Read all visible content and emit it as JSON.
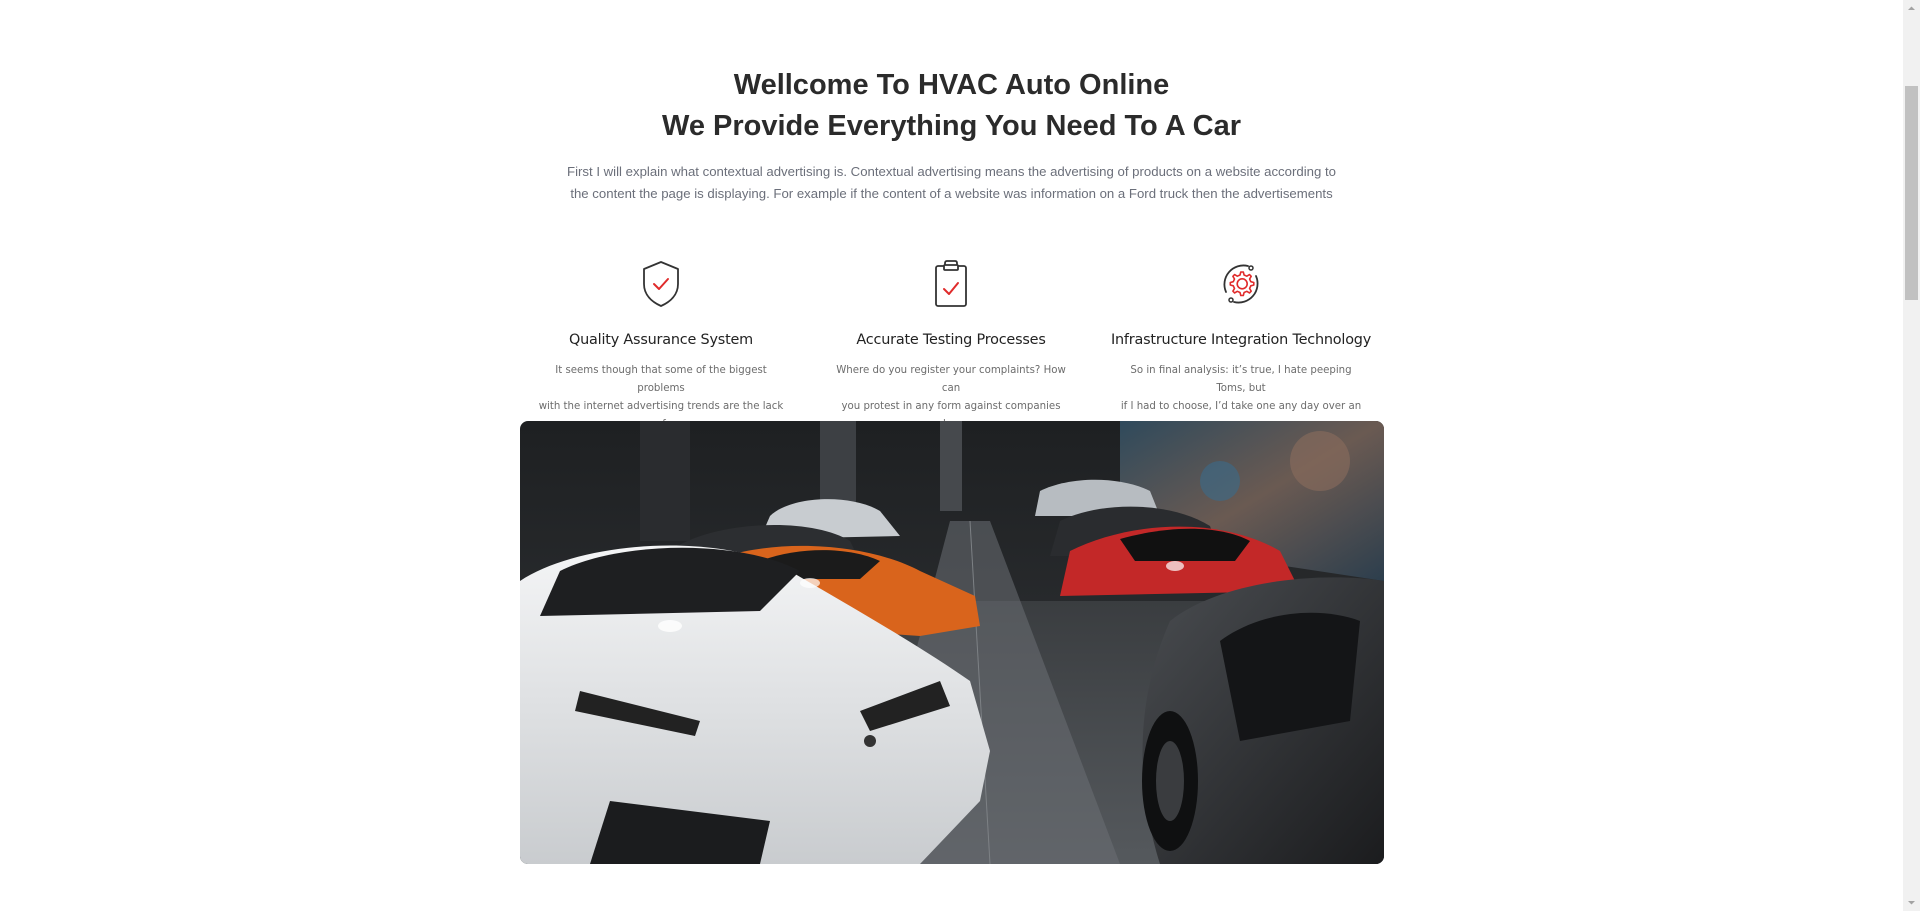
{
  "welcome": {
    "title_line1": "Wellcome To HVAC Auto Online",
    "title_line2": "We Provide Everything You Need To A Car",
    "intro_line1": "First I will explain what contextual advertising is. Contextual advertising means the advertising of products on a website according to",
    "intro_line2": "the content the page is displaying. For example if the content of a website was information on a Ford truck then the advertisements"
  },
  "features": [
    {
      "icon": "shield-check-icon",
      "title": "Quality Assurance System",
      "text_line1": "It seems though that some of the biggest problems",
      "text_line2": "with the internet advertising trends are the lack of"
    },
    {
      "icon": "clipboard-check-icon",
      "title": "Accurate Testing Processes",
      "text_line1": "Where do you register your complaints? How can",
      "text_line2": "you protest in any form against companies whose"
    },
    {
      "icon": "gear-cycle-icon",
      "title": "Infrastructure Integration Technology",
      "text_line1": "So in final analysis: it’s true, I hate peeping Toms, but",
      "text_line2": "if I had to choose, I’d take one any day over an"
    }
  ],
  "colors": {
    "accent": "#e02b2b",
    "heading": "#2b2b2b",
    "body_text": "#6b6f7a",
    "icon_stroke": "#333333"
  }
}
